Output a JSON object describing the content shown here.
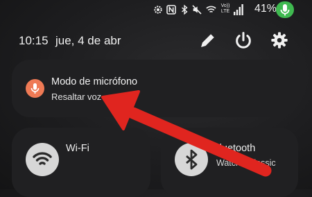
{
  "status_bar": {
    "battery_percent": "41%",
    "network_label": "Vo)) LTE",
    "icons": [
      "settings-gear-icon",
      "nfc-icon",
      "bluetooth-icon",
      "mute-icon",
      "wifi-icon",
      "volte-icon",
      "signal-icon",
      "mic-active-icon"
    ],
    "mic_pill_color": "#3fb950"
  },
  "header": {
    "time": "10:15",
    "date": "jue, 4 de abr",
    "buttons": [
      "edit-pencil-icon",
      "power-icon",
      "settings-icon"
    ]
  },
  "mic_mode": {
    "title": "Modo de micrófono",
    "subtitle": "Resaltar voz",
    "accent_color": "#ef7a55"
  },
  "tiles": {
    "wifi": {
      "label": "Wi-Fi"
    },
    "bluetooth": {
      "label": "Bluetooth",
      "status": "Watch6 Classic"
    }
  },
  "annotation": {
    "arrow_color": "#e0251f"
  }
}
